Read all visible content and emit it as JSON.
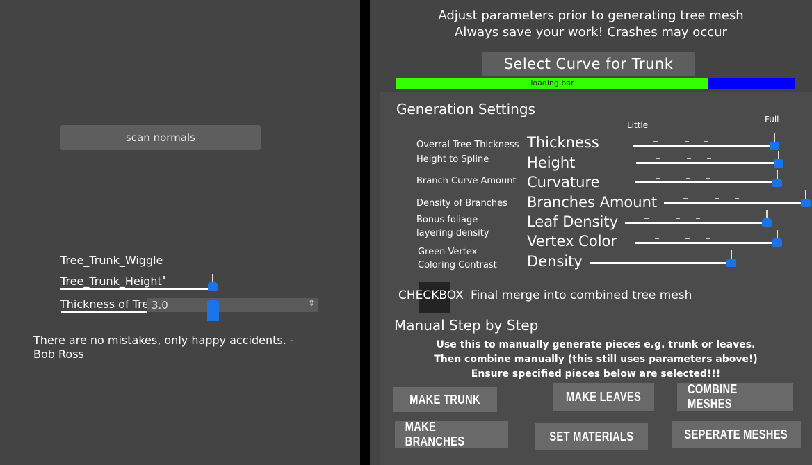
{
  "left_panel": {
    "scan_normals_label": "scan normals",
    "wiggle_label": "Tree_Trunk_Wiggle",
    "height_label": "Tree_Trunk_Height",
    "thickness_label": "Thickness of Tree",
    "thickness_value": "3.0",
    "quote": "There are no mistakes, only happy accidents. - Bob Ross"
  },
  "right_panel": {
    "header_line1": "Adjust parameters prior to generating tree mesh",
    "header_line2": "Always save your work! Crashes may occur",
    "select_curve_label": "Select Curve for Trunk",
    "loading_bar_label": "loading bar",
    "loading_progress": 0.78,
    "generation_title": "Generation Settings",
    "scale_min_label": "Little",
    "scale_max_label": "Full",
    "params": [
      {
        "desc": "Overral Tree Thickness",
        "name": "Thickness",
        "level": 1.0
      },
      {
        "desc": "Height to Spline",
        "name": "Height",
        "level": 1.0
      },
      {
        "desc": "Branch Curve Amount",
        "name": "Curvature",
        "level": 1.0
      },
      {
        "desc": "Density of Branches",
        "name": "Branches Amount",
        "level": 1.0
      },
      {
        "desc": "Bonus foliage layering density",
        "name": "Leaf Density",
        "level": 1.0
      },
      {
        "desc": "Green Vertex Coloring Contrast",
        "name": "Vertex Color",
        "level": 1.0
      },
      {
        "desc": "",
        "name": "Density",
        "level": 1.0
      }
    ],
    "checkbox_label": "CHECKBOX",
    "merge_label": "Final merge into combined tree mesh",
    "manual_title": "Manual Step by Step",
    "info_line1": "Use this to manually generate pieces e.g. trunk or leaves.",
    "info_line2": "Then combine manually (this still uses parameters above!)",
    "info_line3": "Ensure specified pieces below are selected!!!",
    "buttons": {
      "make_trunk": "MAKE TRUNK",
      "make_leaves": "MAKE LEAVES",
      "combine_meshes": "COMBINE MESHES",
      "make_branches": "MAKE BRANCHES",
      "set_materials": "SET MATERIALS",
      "seperate_meshes": "SEPERATE MESHES"
    }
  },
  "colors": {
    "panel_bg": "#444444",
    "progress_fill": "#33ff00",
    "progress_rest": "#0000ff",
    "slider_knob": "#1a73e8"
  }
}
